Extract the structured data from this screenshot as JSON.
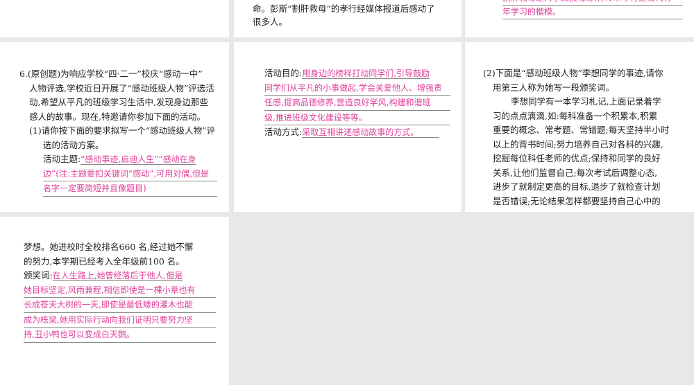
{
  "top": {
    "mid_lines": [
      "命。彭斯“割肝救母”的孝行经媒体报道后感动了",
      "很多人。"
    ],
    "right_answer": [
      "割肝救母是为了回报母恩,你传承孝行是当代青",
      "年学习的楷模。"
    ]
  },
  "q6": {
    "intro": [
      "6.(原创题)为响应学校“四·二一”校庆“感动一中”",
      "人物评选,学校近日开展了“感动班级人物”评选活",
      "动,希望从平凡的班级学习生活中,发现身边那些",
      "感人的故事。现在,特邀请你参加下面的活动。"
    ],
    "part1": [
      "(1)请你按下面的要求拟写一个“感动班级人物”评",
      "选的活动方案。"
    ],
    "theme_label": "活动主题:",
    "theme_answer": [
      "“感动事迹,启迪人生”“感动在身",
      "边”(注:主题要扣关键词“感动”,可用对偶,但是",
      "名字一定要简短并且像题目)"
    ],
    "purpose_label": "活动目的:",
    "purpose_answer": [
      "用身边的榜样打动同学们,引导鼓励",
      "同学们从平凡的小事做起,学会关爱他人、增强责",
      "任感,提高品德修养,营造良好学风,构建和谐班",
      "级,推进班级文化建设等等。"
    ],
    "method_label": "活动方式:",
    "method_answer": "采取互相讲述感动故事的方式。",
    "part2": [
      "(2)下面是“感动班级人物”李想同学的事迹,请你",
      "用第三人称为她写一段颁奖词。"
    ],
    "story": [
      "李想同学有一本学习札记,上面记录着学",
      "习的点点滴滴,如:每科准备一个积累本,积累",
      "重要的概念、常考题、常错题;每天坚持半小时",
      "以上的背书时间;努力培养自己对各科的兴趣,",
      "挖掘每位科任老师的优点;保持和同学的良好",
      "关系,让他们监督自己;每次考试后调整心态,",
      "进步了就制定更高的目标,退步了就检查计划",
      "是否错误;无论结果怎样都要坚持自己心中的"
    ],
    "story_cont": [
      "梦想。她进校时全校排名660 名,经过她不懈",
      "的努力,本学期已经考入全年级前100 名。"
    ],
    "award_label": "颁奖词:",
    "award_answer": [
      "在人生路上,她曾经落后于他人,但是",
      "她目标坚定,风雨兼程,相信即使是一棵小草也有",
      "长成苍天大树的一天,即使是最低矮的灌木也能",
      "成为栋梁,她用实际行动向我们证明只要努力坚",
      "持,丑小鸭也可以变成白天鹅。"
    ]
  }
}
